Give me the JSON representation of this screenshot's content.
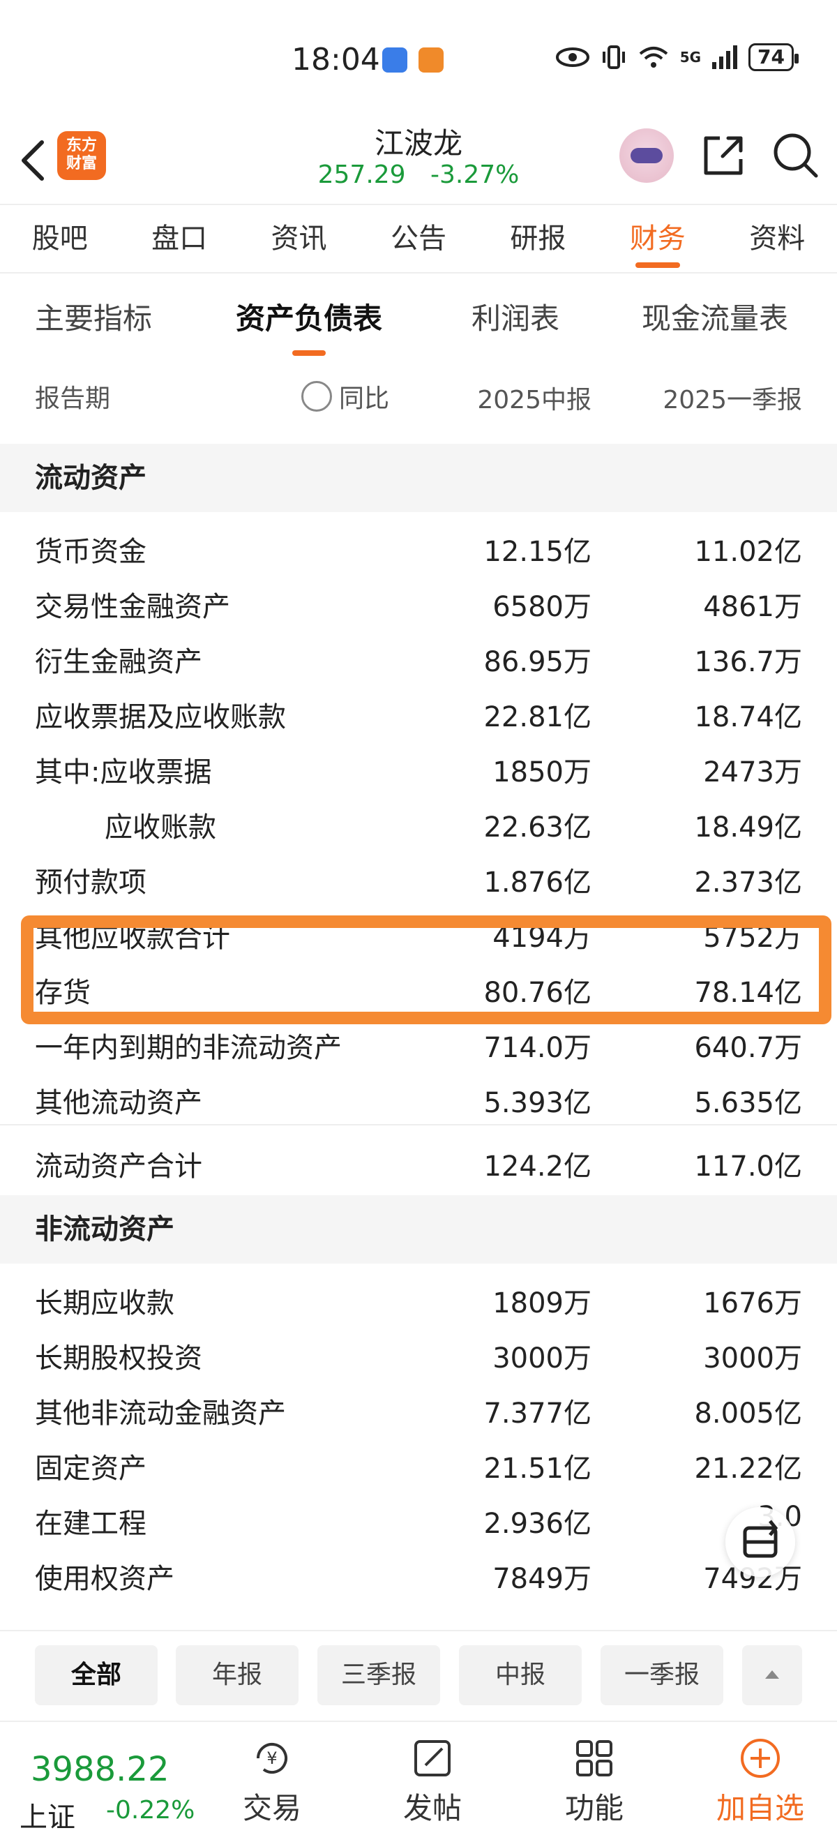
{
  "status": {
    "time": "18:04",
    "network": "5G",
    "battery": "74"
  },
  "header": {
    "logo_line1": "东方",
    "logo_line2": "财富",
    "stock_name": "江波龙",
    "price": "257.29",
    "change_pct": "-3.27%",
    "price_color": "#1a9a3a"
  },
  "top_tabs": [
    {
      "label": "股吧"
    },
    {
      "label": "盘口"
    },
    {
      "label": "资讯"
    },
    {
      "label": "公告"
    },
    {
      "label": "研报"
    },
    {
      "label": "财务"
    },
    {
      "label": "资料"
    }
  ],
  "sub_tabs": [
    {
      "label": "主要指标"
    },
    {
      "label": "资产负债表"
    },
    {
      "label": "利润表"
    },
    {
      "label": "现金流量表"
    }
  ],
  "columns": {
    "period_label": "报告期",
    "yoy_label": "同比",
    "col1": "2025中报",
    "col2": "2025一季报"
  },
  "sections": {
    "current_assets": "流动资产",
    "noncurrent_assets": "非流动资产"
  },
  "current_rows": [
    {
      "name": "货币资金",
      "v1": "12.15亿",
      "v2": "11.02亿"
    },
    {
      "name": "交易性金融资产",
      "v1": "6580万",
      "v2": "4861万"
    },
    {
      "name": "衍生金融资产",
      "v1": "86.95万",
      "v2": "136.7万"
    },
    {
      "name": "应收票据及应收账款",
      "v1": "22.81亿",
      "v2": "18.74亿"
    },
    {
      "name": "其中:应收票据",
      "v1": "1850万",
      "v2": "2473万"
    },
    {
      "name": "应收账款",
      "v1": "22.63亿",
      "v2": "18.49亿"
    },
    {
      "name": "预付款项",
      "v1": "1.876亿",
      "v2": "2.373亿"
    },
    {
      "name": "其他应收款合计",
      "v1": "4194万",
      "v2": "5752万"
    },
    {
      "name": "存货",
      "v1": "80.76亿",
      "v2": "78.14亿"
    },
    {
      "name": "一年内到期的非流动资产",
      "v1": "714.0万",
      "v2": "640.7万"
    },
    {
      "name": "其他流动资产",
      "v1": "5.393亿",
      "v2": "5.635亿"
    }
  ],
  "current_total": {
    "name": "流动资产合计",
    "v1": "124.2亿",
    "v2": "117.0亿"
  },
  "noncurrent_rows": [
    {
      "name": "长期应收款",
      "v1": "1809万",
      "v2": "1676万"
    },
    {
      "name": "长期股权投资",
      "v1": "3000万",
      "v2": "3000万"
    },
    {
      "name": "其他非流动金融资产",
      "v1": "7.377亿",
      "v2": "8.005亿"
    },
    {
      "name": "固定资产",
      "v1": "21.51亿",
      "v2": "21.22亿"
    },
    {
      "name": "在建工程",
      "v1": "2.936亿",
      "v2": "3.0"
    },
    {
      "name": "使用权资产",
      "v1": "7849万",
      "v2": "7492万"
    }
  ],
  "filters": [
    {
      "label": "全部"
    },
    {
      "label": "年报"
    },
    {
      "label": "三季报"
    },
    {
      "label": "中报"
    },
    {
      "label": "一季报"
    }
  ],
  "bottom": {
    "index_value": "3988.22",
    "index_name": "上证",
    "index_change": "-0.22%",
    "nav": [
      {
        "label": "交易",
        "icon": "yuan-cycle-icon"
      },
      {
        "label": "发帖",
        "icon": "edit-icon"
      },
      {
        "label": "功能",
        "icon": "grid-icon"
      },
      {
        "label": "加自选",
        "icon": "plus-circle-icon"
      }
    ]
  },
  "colors": {
    "accent": "#f26b21",
    "down": "#1a9a3a",
    "highlight": "#f58a32"
  }
}
